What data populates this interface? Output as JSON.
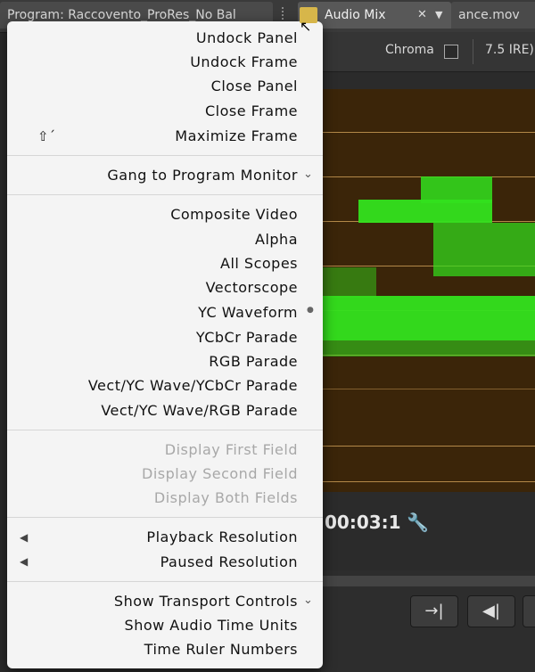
{
  "tabs": {
    "program": "Program: Raccovento_ProRes_No Bal",
    "audio_mixer": "Audio Mix",
    "sequence": "ance.mov"
  },
  "options": {
    "chroma_label": "Chroma",
    "ire_label": "7.5 IRE)"
  },
  "timecode": "00:03:1",
  "menu": {
    "items": [
      {
        "label": "Undock Panel",
        "enabled": true
      },
      {
        "label": "Undock Frame",
        "enabled": true
      },
      {
        "label": "Close Panel",
        "enabled": true
      },
      {
        "label": "Close Frame",
        "enabled": true
      },
      {
        "label": "Maximize Frame",
        "enabled": true,
        "shortcut": "⇧´"
      },
      {
        "label": "Gang to Program Monitor",
        "enabled": true
      },
      {
        "label": "Composite Video",
        "enabled": true
      },
      {
        "label": "Alpha",
        "enabled": true
      },
      {
        "label": "All Scopes",
        "enabled": true
      },
      {
        "label": "Vectorscope",
        "enabled": true
      },
      {
        "label": "YC Waveform",
        "enabled": true,
        "selected": true
      },
      {
        "label": "YCbCr Parade",
        "enabled": true
      },
      {
        "label": "RGB Parade",
        "enabled": true
      },
      {
        "label": "Vect/YC Wave/YCbCr Parade",
        "enabled": true
      },
      {
        "label": "Vect/YC Wave/RGB Parade",
        "enabled": true
      },
      {
        "label": "Display First Field",
        "enabled": false
      },
      {
        "label": "Display Second Field",
        "enabled": false
      },
      {
        "label": "Display Both Fields",
        "enabled": false
      },
      {
        "label": "Playback Resolution",
        "enabled": true,
        "submenu": true
      },
      {
        "label": "Paused Resolution",
        "enabled": true,
        "submenu": true
      },
      {
        "label": "Show Transport Controls",
        "enabled": true
      },
      {
        "label": "Show Audio Time Units",
        "enabled": true
      },
      {
        "label": "Time Ruler Numbers",
        "enabled": true
      }
    ]
  },
  "colors": {
    "scope_bg": "#3b2509",
    "waveform": "#33e21d",
    "menu_bg": "#f4f4f4"
  }
}
